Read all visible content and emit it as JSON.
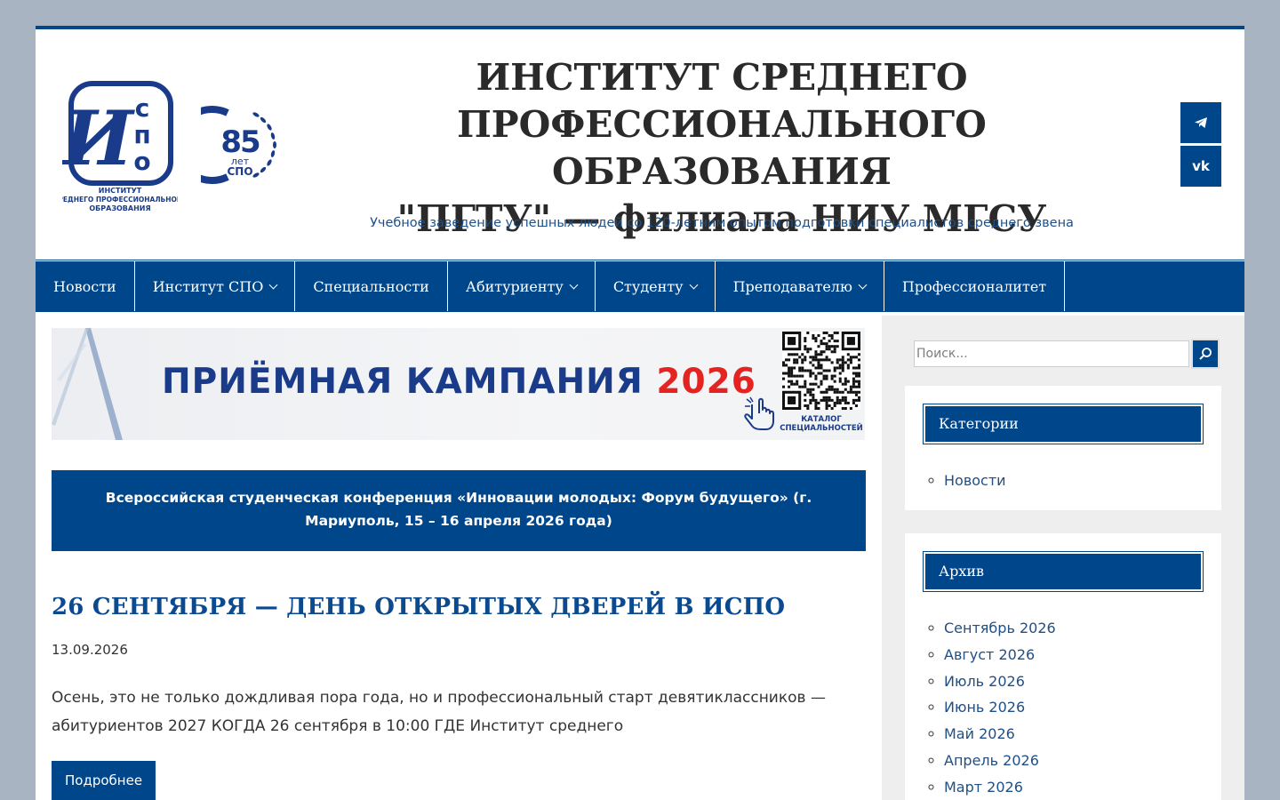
{
  "header": {
    "logo_ispo_text": "ИНСТИТУТ СРЕДНЕГО ПРОФЕССИОНАЛЬНОГО ОБРАЗОВАНИЯ",
    "logo_85_text": "85 лет СПО",
    "title_line1": "ИНСТИТУТ СРЕДНЕГО",
    "title_line2": "ПРОФЕССИОНАЛЬНОГО ОБРАЗОВАНИЯ",
    "title_line3": "\"ПГТУ\" — филиала НИУ МГСУ",
    "description": "Учебное заведение успешных людей со 120-летним опытом подготовки специалистов среднего звена",
    "social": [
      {
        "name": "telegram",
        "icon": "telegram-icon",
        "glyph": "➤"
      },
      {
        "name": "vk",
        "icon": "vk-icon",
        "glyph": "vk"
      }
    ]
  },
  "nav": {
    "items": [
      {
        "label": "Новости",
        "dropdown": false
      },
      {
        "label": "Институт СПО",
        "dropdown": true
      },
      {
        "label": "Специальности",
        "dropdown": false
      },
      {
        "label": "Абитуриенту",
        "dropdown": true
      },
      {
        "label": "Студенту",
        "dropdown": true
      },
      {
        "label": "Преподавателю",
        "dropdown": true
      },
      {
        "label": "Профессионалитет",
        "dropdown": false
      }
    ]
  },
  "banner": {
    "text": "ПРИЁМНАЯ КАМПАНИЯ ",
    "year": "2026",
    "qr_label": "КАТАЛОГ СПЕЦИАЛЬНОСТЕЙ"
  },
  "notice": {
    "text": "Всероссийская студенческая конференция «Инновации молодых: Форум будущего» (г. Мариуполь, 15 – 16 апреля 2026 года)"
  },
  "post": {
    "title": "26 СЕНТЯБРЯ — ДЕНЬ ОТКРЫТЫХ ДВЕРЕЙ В ИСПО",
    "date": "13.09.2026",
    "excerpt": "Осень, это не только дождливая пора года, но и профессиональный старт девятиклассников — абитуриентов 2027 КОГДА 26 сентября в 10:00 ГДЕ Институт среднего",
    "more_label": "Подробнее"
  },
  "sidebar": {
    "search_placeholder": "Поиск...",
    "categories_title": "Категории",
    "categories": [
      "Новости"
    ],
    "archive_title": "Архив",
    "archive": [
      "Сентябрь 2026",
      "Август 2026",
      "Июль 2026",
      "Июнь 2026",
      "Май 2026",
      "Апрель 2026",
      "Март 2026"
    ]
  },
  "colors": {
    "brand": "#00468b",
    "background": "#a9b4c2",
    "accent_red": "#e52421"
  }
}
